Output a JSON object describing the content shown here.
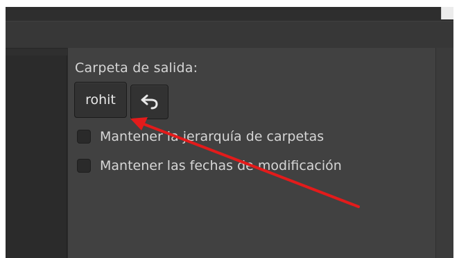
{
  "settings": {
    "output_folder_label": "Carpeta de salida:",
    "output_folder_value": "rohit",
    "options": [
      {
        "label": "Mantener la jerarquía de carpetas"
      },
      {
        "label": "Mantener las fechas de modificación"
      }
    ]
  },
  "icons": {
    "undo": "undo-arrow-icon",
    "annotation": "red-arrow-annotation"
  },
  "colors": {
    "annotation_red": "#e31b1b",
    "panel_bg": "#414141",
    "text": "#d6d6d6"
  }
}
